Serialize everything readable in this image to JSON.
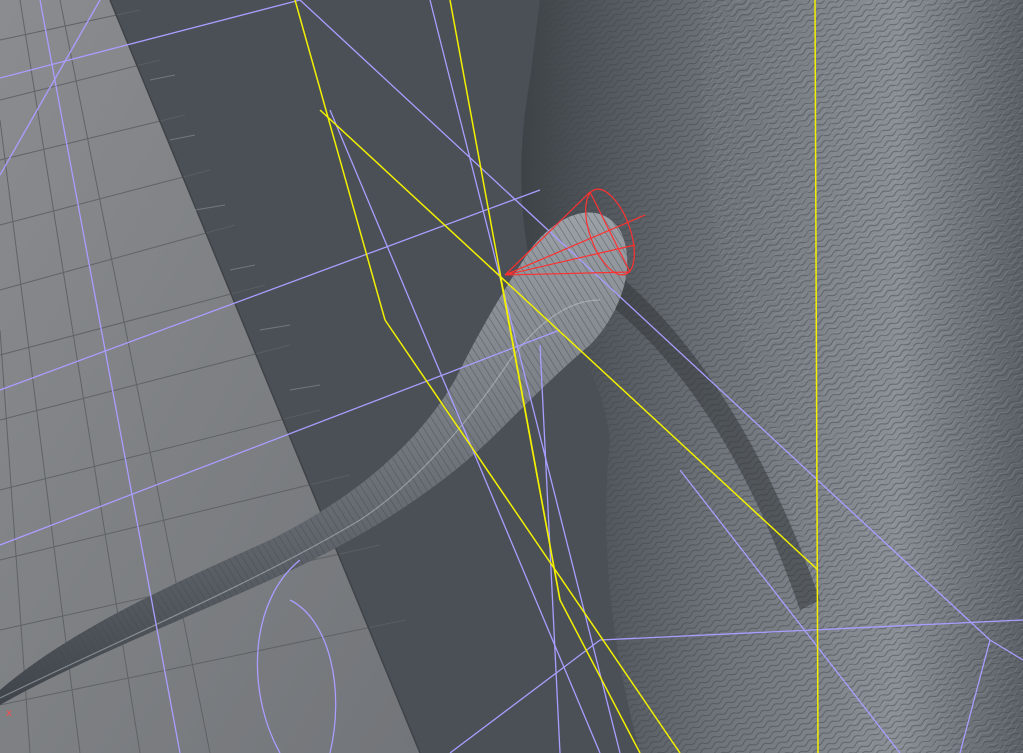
{
  "viewport": {
    "axis_indicator": "x",
    "colors": {
      "background": "#4b5056",
      "ground_plane": "#7d7f82",
      "ground_grid": "#5a5d61",
      "wireframe": "#a99dff",
      "camera_frustum": "#f2f000",
      "spotlight": "#ff3030",
      "mesh": "#7a8086",
      "mesh_shadow": "#383c41",
      "mesh_highlight": "#c2c7cc"
    }
  }
}
